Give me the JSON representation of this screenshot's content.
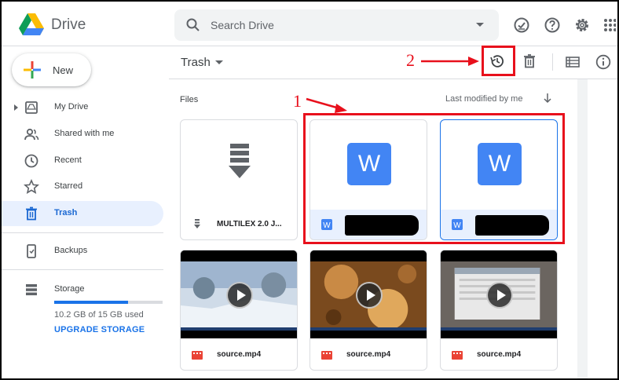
{
  "app": {
    "name": "Drive"
  },
  "search": {
    "placeholder": "Search Drive"
  },
  "header_icons": [
    "offline-ready-icon",
    "help-icon",
    "settings-icon",
    "apps-grid-icon"
  ],
  "new_button": {
    "label": "New"
  },
  "sidebar": {
    "items": [
      {
        "label": "My Drive",
        "icon": "my-drive-icon",
        "expandable": true,
        "active": false
      },
      {
        "label": "Shared with me",
        "icon": "shared-icon",
        "active": false
      },
      {
        "label": "Recent",
        "icon": "clock-icon",
        "active": false
      },
      {
        "label": "Starred",
        "icon": "star-icon",
        "active": false
      },
      {
        "label": "Trash",
        "icon": "trash-icon",
        "active": true
      },
      {
        "label": "Backups",
        "icon": "backup-phone-icon",
        "active": false
      },
      {
        "label": "Storage",
        "icon": "storage-icon",
        "active": false
      }
    ],
    "storage": {
      "used_text": "10.2 GB of 15 GB used",
      "fraction_used": 0.68,
      "upgrade_label": "UPGRADE STORAGE"
    }
  },
  "main": {
    "title": "Trash",
    "toolbar": [
      "restore-icon",
      "delete-forever-icon",
      "list-view-icon",
      "info-icon"
    ],
    "section_label": "Files",
    "sort_label": "Last modified by me",
    "files": [
      {
        "name": "MULTILEX 2.0 J...",
        "type": "archive",
        "selected": false
      },
      {
        "name": "",
        "type": "word",
        "redacted": true,
        "selected": false
      },
      {
        "name": "",
        "type": "word",
        "redacted": true,
        "selected": true
      },
      {
        "name": "source.mp4",
        "type": "video"
      },
      {
        "name": "source.mp4",
        "type": "video"
      },
      {
        "name": "source.mp4",
        "type": "video"
      }
    ]
  },
  "annotations": [
    {
      "number": "1",
      "target": "selected-word-files"
    },
    {
      "number": "2",
      "target": "restore-button"
    }
  ],
  "colors": {
    "accent": "#1a73e8",
    "annotation": "#e8101c",
    "word": "#4285f4",
    "video_icon": "#ea4335"
  }
}
